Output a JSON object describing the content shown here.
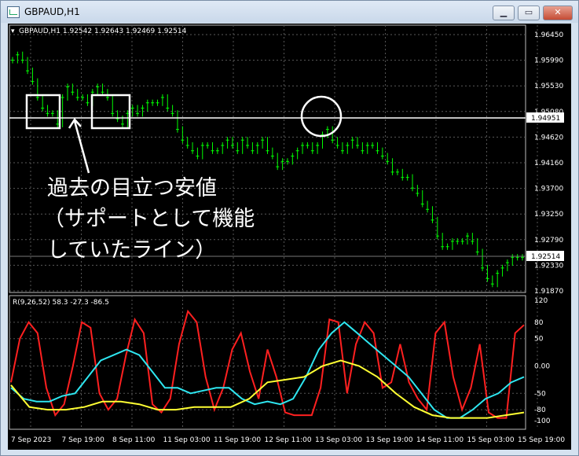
{
  "window": {
    "title": "GBPAUD,H1",
    "buttons": [
      "minimize-button",
      "restore-button",
      "close-button"
    ]
  },
  "colors": {
    "price_up": "#00ff00",
    "rsi_fast": "#ff2020",
    "rsi_mid": "#2ee6f0",
    "rsi_slow": "#ffff33",
    "grid": "#9a9a9a",
    "highlight": "#ffffff"
  },
  "price_chart": {
    "header": "GBPAUD,H1  1.92542 1.92643 1.92469 1.92514",
    "current_price": "1.92514",
    "line_price": "1.94951",
    "yticks": [
      "1.96450",
      "1.95990",
      "1.95530",
      "1.95080",
      "1.94620",
      "1.94160",
      "1.93700",
      "1.93250",
      "1.92790",
      "1.92330",
      "1.91870"
    ]
  },
  "indicator": {
    "header": "R(9,26,52) 58.3 -27.3 -86.5",
    "yticks": [
      "120",
      "80",
      "50",
      "0.00",
      "-50",
      "-80",
      "-100"
    ]
  },
  "xticks": [
    "7 Sep 2023",
    "7 Sep 19:00",
    "8 Sep 11:00",
    "11 Sep 03:00",
    "11 Sep 19:00",
    "12 Sep 11:00",
    "13 Sep 03:00",
    "13 Sep 19:00",
    "14 Sep 11:00",
    "15 Sep 03:00",
    "15 Sep 19:00"
  ],
  "annotation": {
    "line1": "過去の目立つ安値",
    "line2": "（サポートとして機能",
    "line3": "していたライン）"
  },
  "chart_data": {
    "type": "line",
    "title": "GBPAUD,H1",
    "price_ylim": [
      1.9187,
      1.9668
    ],
    "price_series_y": [
      1.962,
      1.963,
      1.962,
      1.96,
      1.958,
      1.955,
      1.953,
      1.952,
      1.952,
      1.95,
      1.955,
      1.957,
      1.956,
      1.955,
      1.955,
      1.954,
      1.956,
      1.957,
      1.956,
      1.955,
      1.952,
      1.951,
      1.95,
      1.952,
      1.953,
      1.952,
      1.953,
      1.954,
      1.954,
      1.954,
      1.955,
      1.953,
      1.952,
      1.949,
      1.947,
      1.946,
      1.945,
      1.944,
      1.946,
      1.946,
      1.945,
      1.945,
      1.946,
      1.947,
      1.946,
      1.945,
      1.947,
      1.946,
      1.945,
      1.946,
      1.947,
      1.945,
      1.944,
      1.942,
      1.943,
      1.943,
      1.944,
      1.945,
      1.946,
      1.946,
      1.945,
      1.946,
      1.948,
      1.949,
      1.947,
      1.946,
      1.945,
      1.946,
      1.947,
      1.946,
      1.945,
      1.946,
      1.946,
      1.945,
      1.944,
      1.943,
      1.941,
      1.941,
      1.94,
      1.94,
      1.938,
      1.937,
      1.935,
      1.934,
      1.932,
      1.929,
      1.927,
      1.927,
      1.928,
      1.928,
      1.928,
      1.929,
      1.928,
      1.926,
      1.923,
      1.921,
      1.92,
      1.922,
      1.923,
      1.924,
      1.925,
      1.925,
      1.925
    ],
    "series": [
      {
        "name": "9",
        "values": [
          -30,
          50,
          80,
          60,
          -40,
          -90,
          -70,
          0,
          80,
          70,
          -50,
          -80,
          -60,
          20,
          85,
          60,
          -70,
          -85,
          -60,
          40,
          100,
          80,
          -20,
          -80,
          -40,
          30,
          60,
          -10,
          -60,
          30,
          -20,
          -85,
          -90,
          -90,
          -90,
          -40,
          85,
          80,
          -50,
          40,
          80,
          60,
          -40,
          -30,
          40,
          -30,
          -60,
          -80,
          60,
          80,
          -20,
          -80,
          -40,
          40,
          -85,
          -95,
          -95,
          60,
          75
        ]
      },
      {
        "name": "26",
        "values": [
          -40,
          -60,
          -65,
          -65,
          -55,
          -50,
          -20,
          10,
          20,
          30,
          20,
          -10,
          -40,
          -40,
          -50,
          -45,
          -40,
          -40,
          -60,
          -70,
          -65,
          -70,
          -60,
          -20,
          30,
          60,
          80,
          60,
          40,
          20,
          0,
          -20,
          -50,
          -80,
          -95,
          -95,
          -80,
          -60,
          -50,
          -30,
          -20
        ]
      },
      {
        "name": "52",
        "values": [
          -35,
          -75,
          -80,
          -80,
          -75,
          -65,
          -65,
          -70,
          -80,
          -80,
          -75,
          -75,
          -75,
          -60,
          -30,
          -25,
          -20,
          0,
          10,
          0,
          -20,
          -50,
          -75,
          -90,
          -95,
          -95,
          -95,
          -90,
          -85
        ]
      }
    ],
    "ylim": [
      -110,
      120
    ]
  }
}
